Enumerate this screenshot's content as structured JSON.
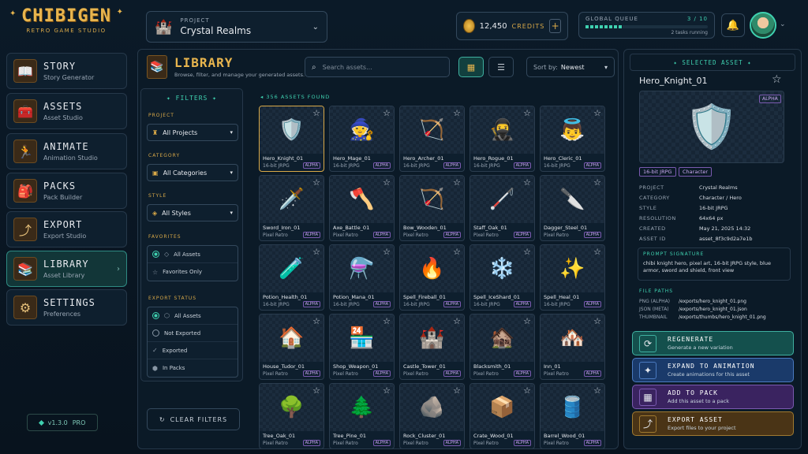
{
  "brand": {
    "name": "CHIBIGEN",
    "tagline": "RETRO GAME STUDIO",
    "version": "v1.3.0",
    "tier": "PRO"
  },
  "nav": [
    {
      "title": "STORY",
      "sub": "Story Generator",
      "icon": "book-icon",
      "active": false
    },
    {
      "title": "ASSETS",
      "sub": "Asset Studio",
      "icon": "chest-icon",
      "active": false
    },
    {
      "title": "ANIMATE",
      "sub": "Animation Studio",
      "icon": "running-character-icon",
      "active": false
    },
    {
      "title": "PACKS",
      "sub": "Pack Builder",
      "icon": "backpack-icon",
      "active": false
    },
    {
      "title": "EXPORT",
      "sub": "Export Studio",
      "icon": "export-icon",
      "active": false
    },
    {
      "title": "LIBRARY",
      "sub": "Asset Library",
      "icon": "bookshelf-icon",
      "active": true
    },
    {
      "title": "SETTINGS",
      "sub": "Preferences",
      "icon": "gear-icon",
      "active": false
    }
  ],
  "project": {
    "label": "PROJECT",
    "value": "Crystal Realms"
  },
  "credits": {
    "amount": "12,450",
    "label": "CREDITS"
  },
  "queue": {
    "label": "GLOBAL QUEUE",
    "count": "3 / 10",
    "progress": 0.3,
    "status": "2 tasks running"
  },
  "library": {
    "title": "LIBRARY",
    "subtitle": "Browse, filter, and manage your generated assets.",
    "search_placeholder": "Search assets...",
    "sort_label": "Sort by:",
    "sort_value": "Newest",
    "count": "356 ASSETS FOUND"
  },
  "filters": {
    "title": "FILTERS",
    "project_label": "PROJECT",
    "project_value": "All Projects",
    "category_label": "CATEGORY",
    "category_value": "All Categories",
    "style_label": "STYLE",
    "style_value": "All Styles",
    "favorites_label": "FAVORITES",
    "favorites": [
      "All Assets",
      "Favorites Only"
    ],
    "export_label": "EXPORT STATUS",
    "export": [
      "All Assets",
      "Not Exported",
      "Exported",
      "In Packs"
    ],
    "clear": "CLEAR FILTERS"
  },
  "assets": [
    {
      "name": "Hero_Knight_01",
      "style": "16-bit JRPG",
      "badge": "ALPHA",
      "art": "🛡️"
    },
    {
      "name": "Hero_Mage_01",
      "style": "16-bit JRPG",
      "badge": "ALPHA",
      "art": "🧙"
    },
    {
      "name": "Hero_Archer_01",
      "style": "16-bit JRPG",
      "badge": "ALPHA",
      "art": "🏹"
    },
    {
      "name": "Hero_Rogue_01",
      "style": "16-bit JRPG",
      "badge": "ALPHA",
      "art": "🥷"
    },
    {
      "name": "Hero_Cleric_01",
      "style": "16-bit JRPG",
      "badge": "ALPHA",
      "art": "👼"
    },
    {
      "name": "Sword_Iron_01",
      "style": "Pixel Retro",
      "badge": "ALPHA",
      "art": "🗡️"
    },
    {
      "name": "Axe_Battle_01",
      "style": "Pixel Retro",
      "badge": "ALPHA",
      "art": "🪓"
    },
    {
      "name": "Bow_Wooden_01",
      "style": "Pixel Retro",
      "badge": "ALPHA",
      "art": "🏹"
    },
    {
      "name": "Staff_Oak_01",
      "style": "Pixel Retro",
      "badge": "ALPHA",
      "art": "🦯"
    },
    {
      "name": "Dagger_Steel_01",
      "style": "Pixel Retro",
      "badge": "ALPHA",
      "art": "🔪"
    },
    {
      "name": "Potion_Health_01",
      "style": "16-bit JRPG",
      "badge": "ALPHA",
      "art": "🧪"
    },
    {
      "name": "Potion_Mana_01",
      "style": "16-bit JRPG",
      "badge": "ALPHA",
      "art": "⚗️"
    },
    {
      "name": "Spell_Fireball_01",
      "style": "16-bit JRPG",
      "badge": "ALPHA",
      "art": "🔥"
    },
    {
      "name": "Spell_IceShard_01",
      "style": "16-bit JRPG",
      "badge": "ALPHA",
      "art": "❄️"
    },
    {
      "name": "Spell_Heal_01",
      "style": "16-bit JRPG",
      "badge": "ALPHA",
      "art": "✨"
    },
    {
      "name": "House_Tudor_01",
      "style": "Pixel Retro",
      "badge": "ALPHA",
      "art": "🏠"
    },
    {
      "name": "Shop_Weapon_01",
      "style": "Pixel Retro",
      "badge": "ALPHA",
      "art": "🏪"
    },
    {
      "name": "Castle_Tower_01",
      "style": "Pixel Retro",
      "badge": "ALPHA",
      "art": "🏰"
    },
    {
      "name": "Blacksmith_01",
      "style": "Pixel Retro",
      "badge": "ALPHA",
      "art": "🏚️"
    },
    {
      "name": "Inn_01",
      "style": "Pixel Retro",
      "badge": "ALPHA",
      "art": "🏘️"
    },
    {
      "name": "Tree_Oak_01",
      "style": "Pixel Retro",
      "badge": "ALPHA",
      "art": "🌳"
    },
    {
      "name": "Tree_Pine_01",
      "style": "Pixel Retro",
      "badge": "ALPHA",
      "art": "🌲"
    },
    {
      "name": "Rock_Cluster_01",
      "style": "Pixel Retro",
      "badge": "ALPHA",
      "art": "🪨"
    },
    {
      "name": "Crate_Wood_01",
      "style": "Pixel Retro",
      "badge": "ALPHA",
      "art": "📦"
    },
    {
      "name": "Barrel_Wood_01",
      "style": "Pixel Retro",
      "badge": "ALPHA",
      "art": "🛢️"
    }
  ],
  "detail": {
    "header": "SELECTED ASSET",
    "name": "Hero_Knight_01",
    "badge": "ALPHA",
    "tags": [
      "16-bit JRPG",
      "Character"
    ],
    "props": [
      [
        "PROJECT",
        "Crystal Realms"
      ],
      [
        "CATEGORY",
        "Character / Hero"
      ],
      [
        "STYLE",
        "16-bit JRPG"
      ],
      [
        "RESOLUTION",
        "64x64 px"
      ],
      [
        "CREATED",
        "May 21, 2025 14:32"
      ],
      [
        "ASSET ID",
        "asset_8f3c9d2a7e1b"
      ]
    ],
    "prompt_label": "PROMPT SIGNATURE",
    "prompt": "chibi knight hero, pixel art, 16-bit JRPG style, blue armor, sword and shield, front view",
    "paths_label": "FILE PATHS",
    "paths": [
      [
        "PNG (ALPHA)",
        "/exports/hero_knight_01.png"
      ],
      [
        "JSON (META)",
        "/exports/hero_knight_01.json"
      ],
      [
        "THUMBNAIL",
        "/exports/thumbs/hero_knight_01.png"
      ]
    ]
  },
  "actions": [
    {
      "title": "REGENERATE",
      "sub": "Generate a new variation",
      "icon": "refresh-icon",
      "color": "#14504d",
      "border": "#3fb0a0"
    },
    {
      "title": "EXPAND TO ANIMATION",
      "sub": "Create animations for this asset",
      "icon": "animation-icon",
      "color": "#1a3a6a",
      "border": "#4a7ac0"
    },
    {
      "title": "ADD TO PACK",
      "sub": "Add this asset to a pack",
      "icon": "pack-icon",
      "color": "#3a2360",
      "border": "#7a5ab0"
    },
    {
      "title": "EXPORT ASSET",
      "sub": "Export files to your project",
      "icon": "export-icon",
      "color": "#4a3416",
      "border": "#a07a30"
    }
  ]
}
